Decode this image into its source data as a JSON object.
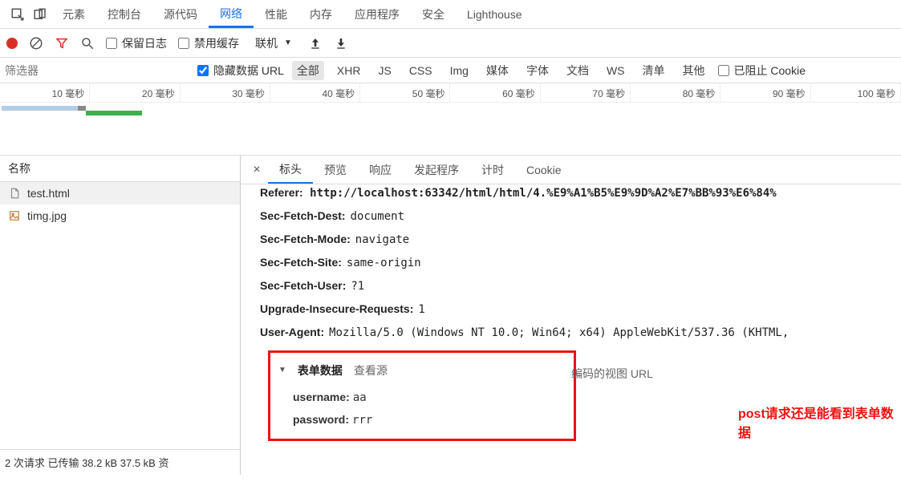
{
  "topTabs": {
    "elements": "元素",
    "console": "控制台",
    "sources": "源代码",
    "network": "网络",
    "performance": "性能",
    "memory": "内存",
    "application": "应用程序",
    "security": "安全",
    "lighthouse": "Lighthouse"
  },
  "toolbar": {
    "preserveLog": "保留日志",
    "disableCache": "禁用缓存",
    "online": "联机"
  },
  "filter": {
    "placeholder": "筛选器",
    "hideDataUrl": "隐藏数据 URL",
    "all": "全部",
    "types": [
      "XHR",
      "JS",
      "CSS",
      "Img",
      "媒体",
      "字体",
      "文档",
      "WS",
      "清单",
      "其他"
    ],
    "blockedCookies": "已阻止 Cookie"
  },
  "timeline": {
    "ticks": [
      "10 毫秒",
      "20 毫秒",
      "30 毫秒",
      "40 毫秒",
      "50 毫秒",
      "60 毫秒",
      "70 毫秒",
      "80 毫秒",
      "90 毫秒",
      "100 毫秒"
    ]
  },
  "leftPanel": {
    "header": "名称",
    "items": [
      "test.html",
      "timg.jpg"
    ],
    "footer": "2 次请求  已传输 38.2 kB  37.5 kB 资"
  },
  "detailTabs": {
    "headers": "标头",
    "preview": "预览",
    "response": "响应",
    "initiator": "发起程序",
    "timing": "计时",
    "cookies": "Cookie"
  },
  "headers": {
    "refererLabel": "Referer:",
    "refererVal": "http://localhost:63342/html/html/4.%E9%A1%B5%E9%9D%A2%E7%BB%93%E6%84%",
    "rows": [
      {
        "k": "Sec-Fetch-Dest:",
        "v": "document"
      },
      {
        "k": "Sec-Fetch-Mode:",
        "v": "navigate"
      },
      {
        "k": "Sec-Fetch-Site:",
        "v": "same-origin"
      },
      {
        "k": "Sec-Fetch-User:",
        "v": "?1"
      },
      {
        "k": "Upgrade-Insecure-Requests:",
        "v": "1"
      },
      {
        "k": "User-Agent:",
        "v": "Mozilla/5.0 (Windows NT 10.0; Win64; x64) AppleWebKit/537.36 (KHTML,"
      }
    ]
  },
  "formData": {
    "title": "表单数据",
    "viewSource": "查看源",
    "viewEncoded": "编码的视图 URL",
    "fields": [
      {
        "k": "username:",
        "v": "aa"
      },
      {
        "k": "password:",
        "v": "rrr"
      }
    ]
  },
  "annotation": "post请求还是能看到表单数据"
}
